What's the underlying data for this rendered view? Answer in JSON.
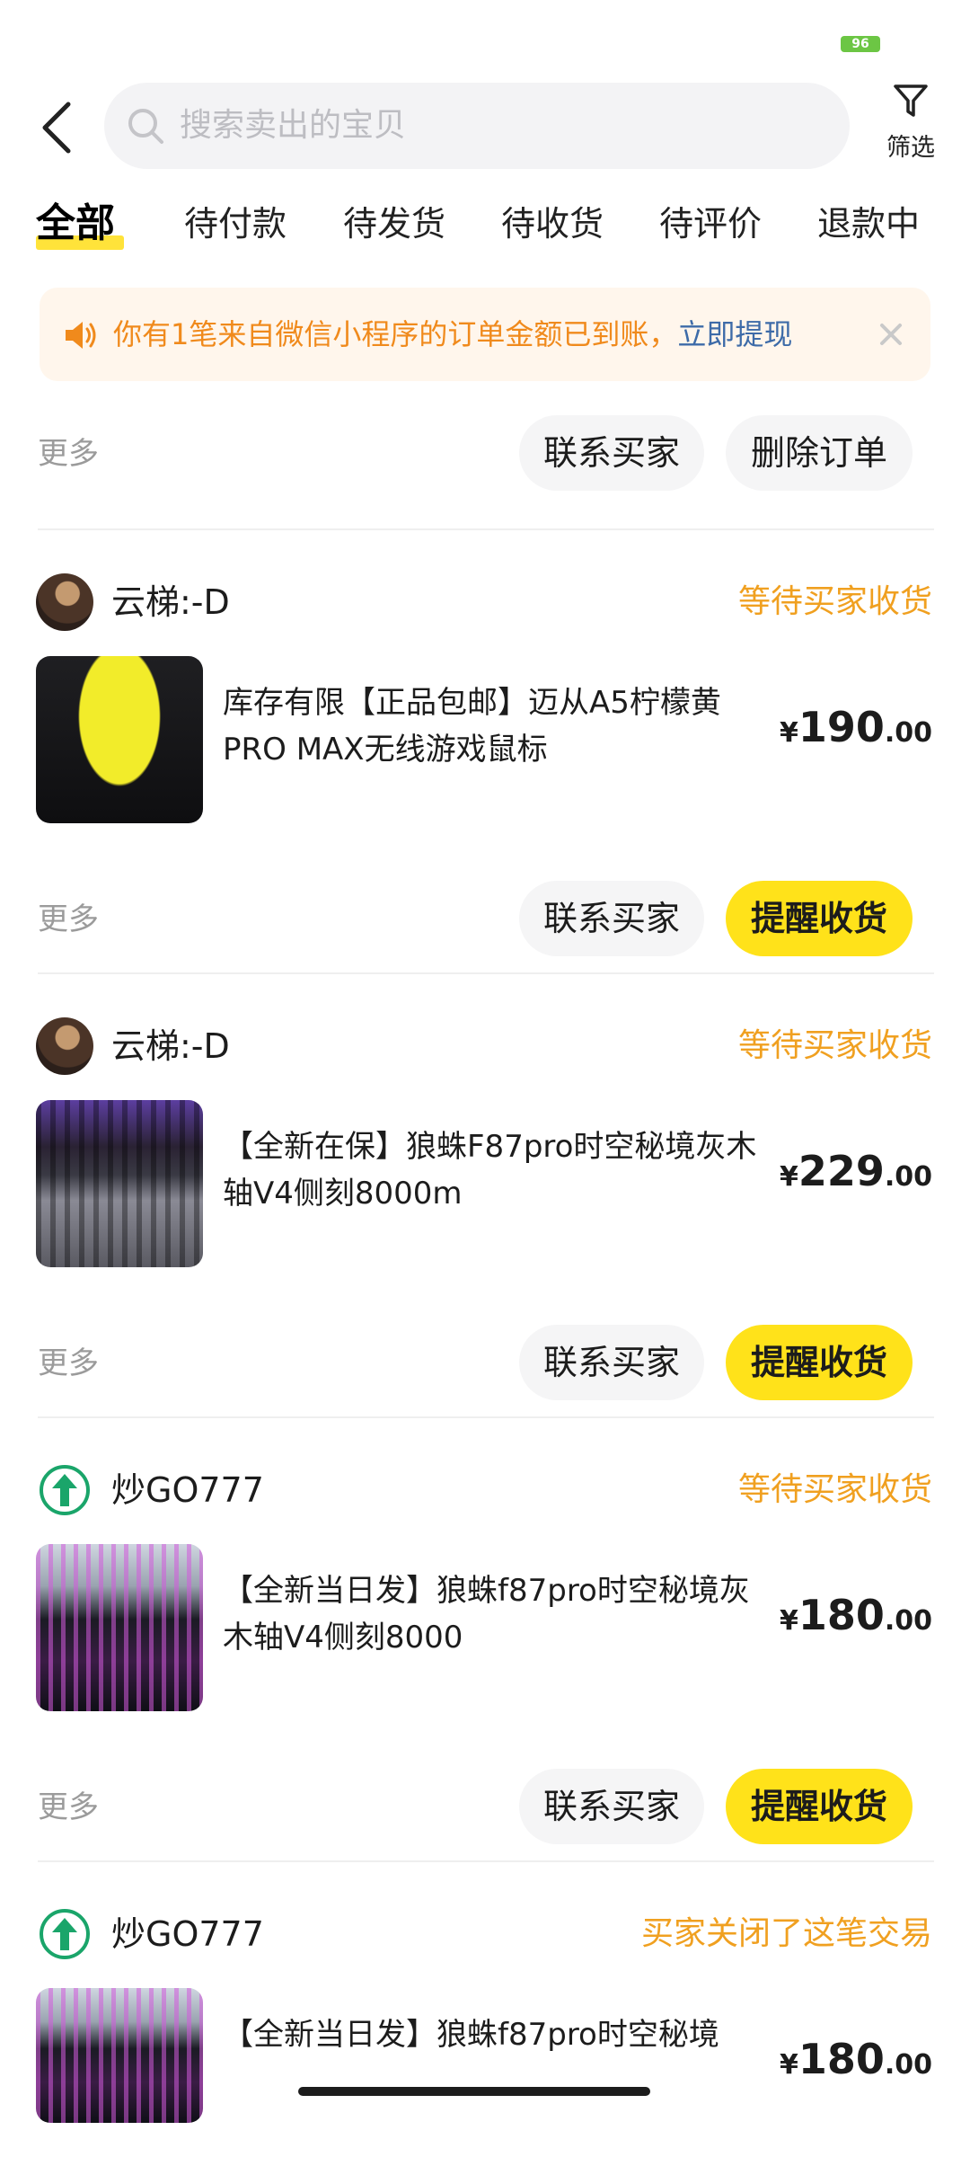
{
  "status_bar": {
    "battery": "96"
  },
  "search": {
    "placeholder": "搜索卖出的宝贝"
  },
  "filter": {
    "label": "筛选"
  },
  "tabs": [
    "全部",
    "待付款",
    "待发货",
    "待收货",
    "待评价",
    "退款中"
  ],
  "banner": {
    "text": "你有1笔来自微信小程序的订单金额已到账，",
    "link": "立即提现"
  },
  "top_actions": {
    "more": "更多",
    "contact": "联系买家",
    "delete": "删除订单"
  },
  "orders": [
    {
      "buyer": "云梯:-D",
      "status": "等待买家收货",
      "title": "库存有限【正品包邮】迈从A5柠檬黄PRO MAX无线游戏鼠标",
      "currency": "¥",
      "price_int": "190",
      "price_dec": ".00",
      "more": "更多",
      "contact": "联系买家",
      "primary": "提醒收货"
    },
    {
      "buyer": "云梯:-D",
      "status": "等待买家收货",
      "title": "【全新在保】狼蛛F87pro时空秘境灰木轴V4侧刻8000m",
      "currency": "¥",
      "price_int": "229",
      "price_dec": ".00",
      "more": "更多",
      "contact": "联系买家",
      "primary": "提醒收货"
    },
    {
      "buyer": "炒GO777",
      "status": "等待买家收货",
      "title": "【全新当日发】狼蛛f87pro时空秘境灰木轴V4侧刻8000",
      "currency": "¥",
      "price_int": "180",
      "price_dec": ".00",
      "more": "更多",
      "contact": "联系买家",
      "primary": "提醒收货"
    },
    {
      "buyer": "炒GO777",
      "status": "买家关闭了这笔交易",
      "title": "【全新当日发】狼蛛f87pro时空秘境",
      "currency": "¥",
      "price_int": "180",
      "price_dec": ".00"
    }
  ],
  "colors": {
    "accent_yellow": "#ffe21a",
    "status_orange": "#f0a020",
    "banner_text": "#f08a1c",
    "link_blue": "#3d6ba8"
  },
  "icons": [
    "back-arrow-icon",
    "search-icon",
    "filter-icon",
    "speaker-icon",
    "close-icon",
    "green-arrow-logo-icon"
  ]
}
